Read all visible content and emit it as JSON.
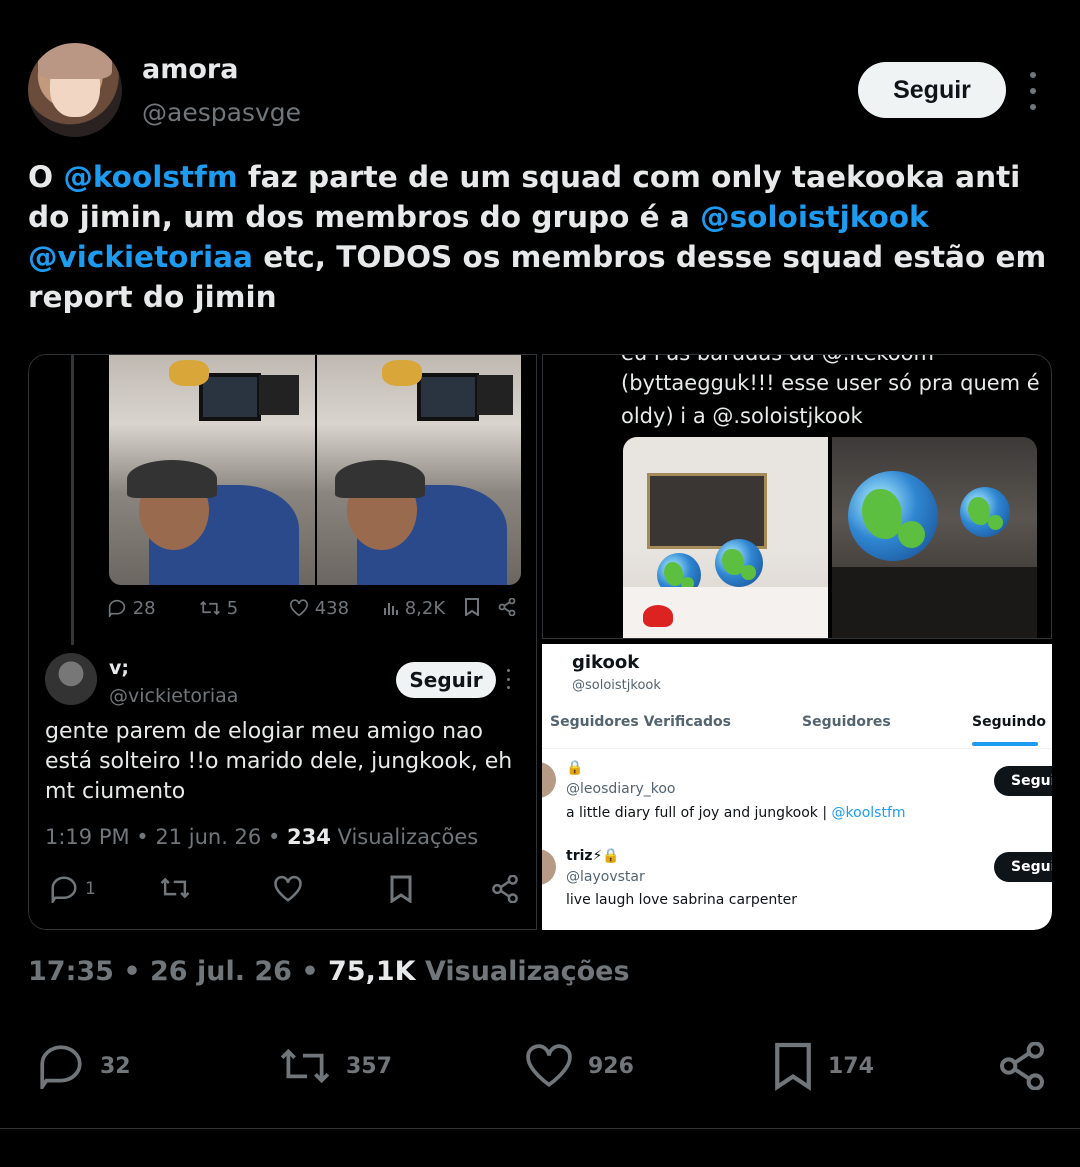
{
  "author": {
    "name": "amora",
    "handle": "@aespasvge",
    "follow_label": "Seguir"
  },
  "tweet": {
    "parts": [
      {
        "t": "O ",
        "link": false
      },
      {
        "t": "@koolstfm",
        "link": true
      },
      {
        "t": " faz parte de um squad com only taekooka anti do jimin, um dos membros do grupo é a ",
        "link": false
      },
      {
        "t": "@soloistjkook",
        "link": true
      },
      {
        "t": " ",
        "link": false
      },
      {
        "t": "@vickietoriaa",
        "link": true
      },
      {
        "t": " etc, TODOS os membros desse squad estão em report do jimin",
        "link": false
      }
    ]
  },
  "media": {
    "left_card": {
      "stats": {
        "replies": "28",
        "retweets": "5",
        "likes": "438",
        "views": "8,2K"
      },
      "reply": {
        "name": "v;",
        "handle": "@vickietoriaa",
        "follow_label": "Seguir",
        "text": "gente parem de elogiar meu amigo nao está solteiro !!o marido dele, jungkook, eh mt ciumento",
        "time": "1:19 PM • 21 jun. 26 • ",
        "views_count": "234",
        "views_label": " Visualizações",
        "reply_count": "1"
      }
    },
    "top_right": {
      "text_top": "eu i as barudas da @.itekoom",
      "text": "(byttaegguk!!! esse user só pra quem é oldy) i a @.soloistjkook"
    },
    "bottom_right": {
      "name": "gikook",
      "handle": "@soloistjkook",
      "tabs": [
        "Seguidores Verificados",
        "Seguidores",
        "Seguindo"
      ],
      "active_tab": "Seguindo",
      "rows": [
        {
          "name": "🔒",
          "handle": "@leosdiary_koo",
          "bio": "a little diary full of joy and jungkook | ",
          "bio_link": "@koolstfm",
          "button": "Seguir"
        },
        {
          "name": "triz⚡🔒",
          "handle": "@layovstar",
          "bio": "live laugh love sabrina carpenter",
          "bio_link": "",
          "button": "Seguir"
        }
      ]
    }
  },
  "meta": {
    "time": "17:35 • 26 jul. 26 • ",
    "views_count": "75,1K",
    "views_label": " Visualizações"
  },
  "actions": {
    "replies": "32",
    "retweets": "357",
    "likes": "926",
    "bookmarks": "174"
  },
  "colors": {
    "background": "#000000",
    "text": "#e7e9ea",
    "muted": "#71767b",
    "link": "#1d9bf0"
  }
}
